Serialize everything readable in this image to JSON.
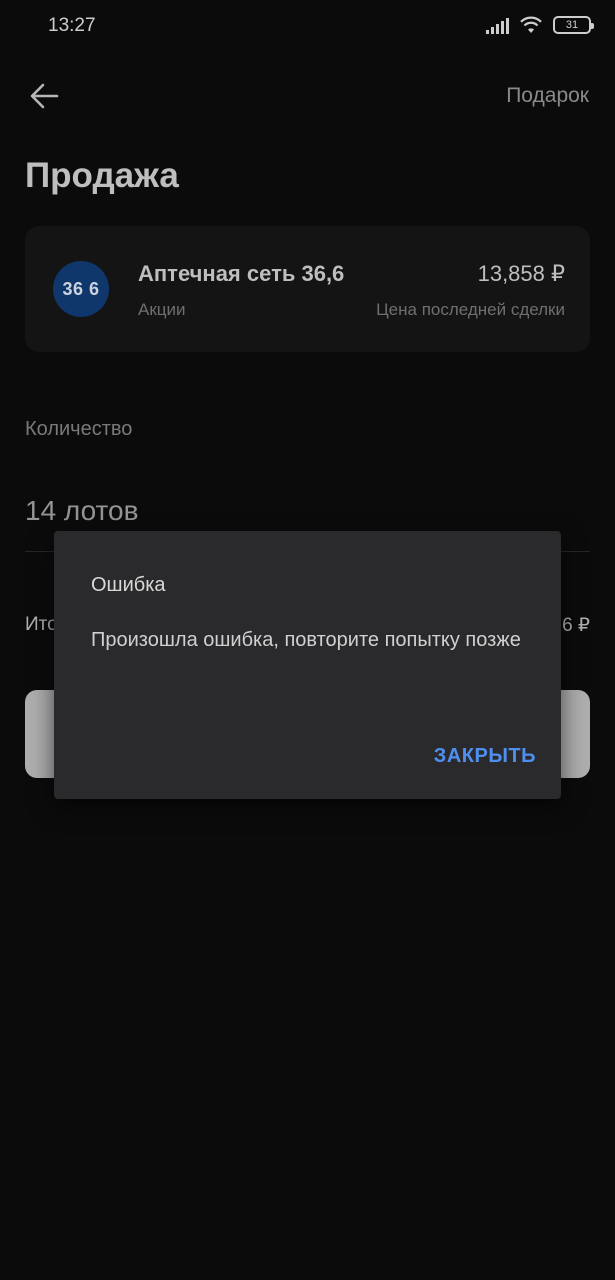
{
  "status_bar": {
    "time": "13:27",
    "battery": "31",
    "icons": [
      "signal-icon",
      "wifi-icon",
      "battery-icon"
    ]
  },
  "header": {
    "back_icon": "arrow-left-icon",
    "gift_label": "Подарок",
    "title": "Продажа"
  },
  "instrument": {
    "logo_text": "36 6",
    "name": "Аптечная сеть 36,6",
    "type": "Акции",
    "price": "13,858 ₽",
    "price_label": "Цена последней сделки"
  },
  "quantity": {
    "label": "Количество",
    "value": "14 лотов"
  },
  "total": {
    "label_visible": "Ито",
    "value_visible": "6 ₽"
  },
  "dialog": {
    "title": "Ошибка",
    "message": "Произошла ошибка, повторите попытку позже",
    "close_label": "ЗАКРЫТЬ"
  },
  "colors": {
    "background": "#0d0d0d",
    "card": "#171718",
    "dialog": "#2a2a2c",
    "accent": "#4e8ff0",
    "logo": "#123f7a"
  }
}
